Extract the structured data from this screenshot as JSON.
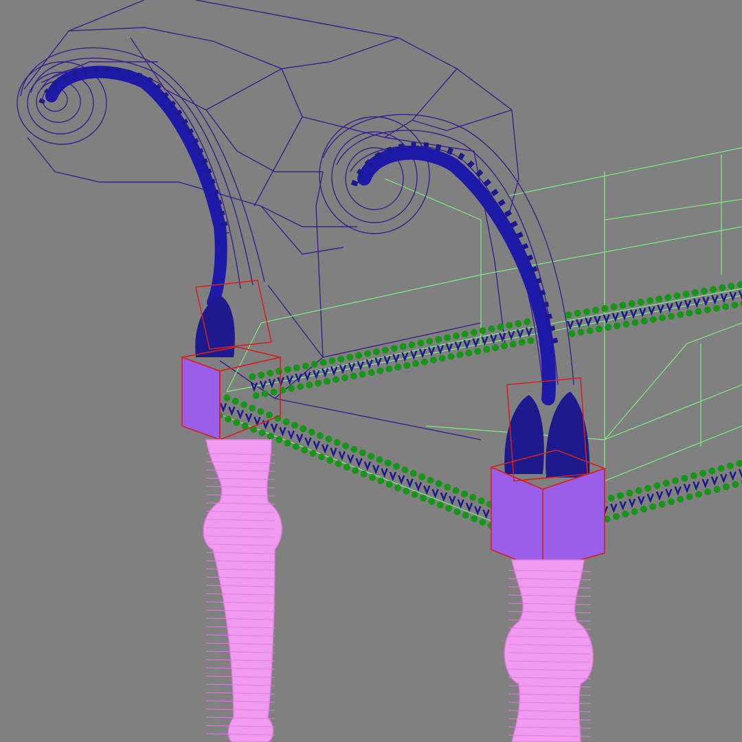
{
  "viewport": {
    "background_color": "#808080"
  },
  "model": {
    "subject": "wireframe-bench",
    "colors": {
      "cushion_wire": "#3a1f8c",
      "arm_carving": "#1d1aa8",
      "frame_wire": "#7cf07c",
      "bead_trim": "#169616",
      "fringe_trim": "#1c1a8c",
      "block_wire": "#d42020",
      "block_fill": "#9a5ee8",
      "leg_wire": "#e07be0",
      "leg_fill": "#f09af0"
    }
  }
}
